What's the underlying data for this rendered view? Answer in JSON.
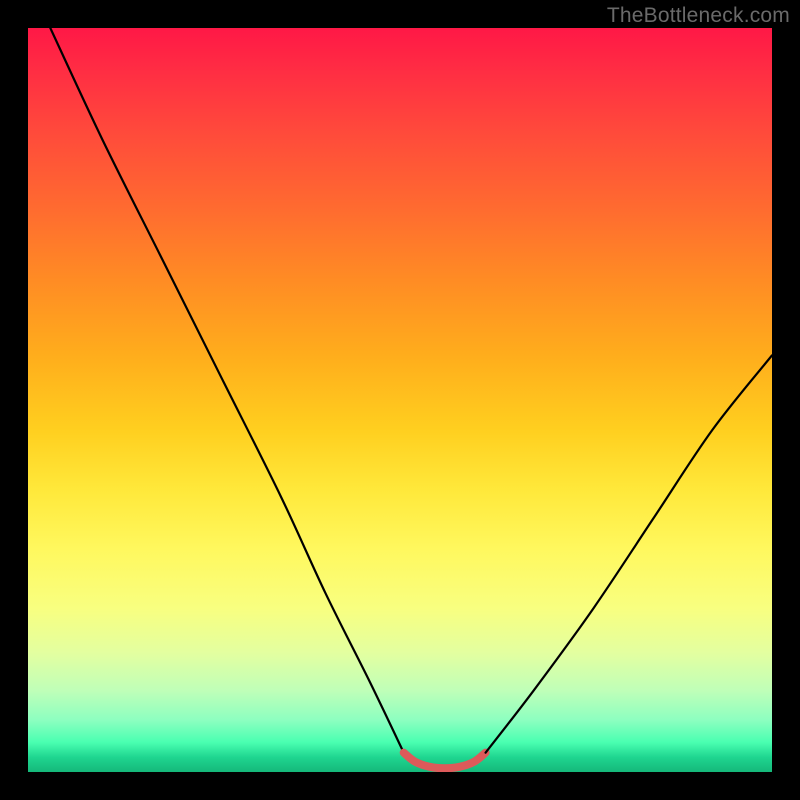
{
  "watermark": "TheBottleneck.com",
  "chart_data": {
    "type": "line",
    "title": "",
    "xlabel": "",
    "ylabel": "",
    "xlim": [
      0,
      100
    ],
    "ylim": [
      0,
      100
    ],
    "grid": false,
    "legend": false,
    "series": [
      {
        "name": "left-branch",
        "color": "#000000",
        "x": [
          3,
          10,
          18,
          26,
          34,
          40,
          46,
          50.5
        ],
        "y": [
          100,
          85,
          69,
          53,
          37,
          24,
          12,
          2.6
        ]
      },
      {
        "name": "trough",
        "color": "#dd5a5a",
        "x": [
          50.5,
          52,
          54,
          56,
          58,
          60,
          61.5
        ],
        "y": [
          2.6,
          1.4,
          0.7,
          0.5,
          0.7,
          1.4,
          2.6
        ]
      },
      {
        "name": "right-branch",
        "color": "#000000",
        "x": [
          61.5,
          68,
          76,
          84,
          92,
          100
        ],
        "y": [
          2.6,
          11,
          22,
          34,
          46,
          56
        ]
      }
    ]
  },
  "colors": {
    "background": "#000000",
    "watermark": "#6a6a6a",
    "curve_black": "#000000",
    "curve_trough": "#dd5a5a"
  }
}
